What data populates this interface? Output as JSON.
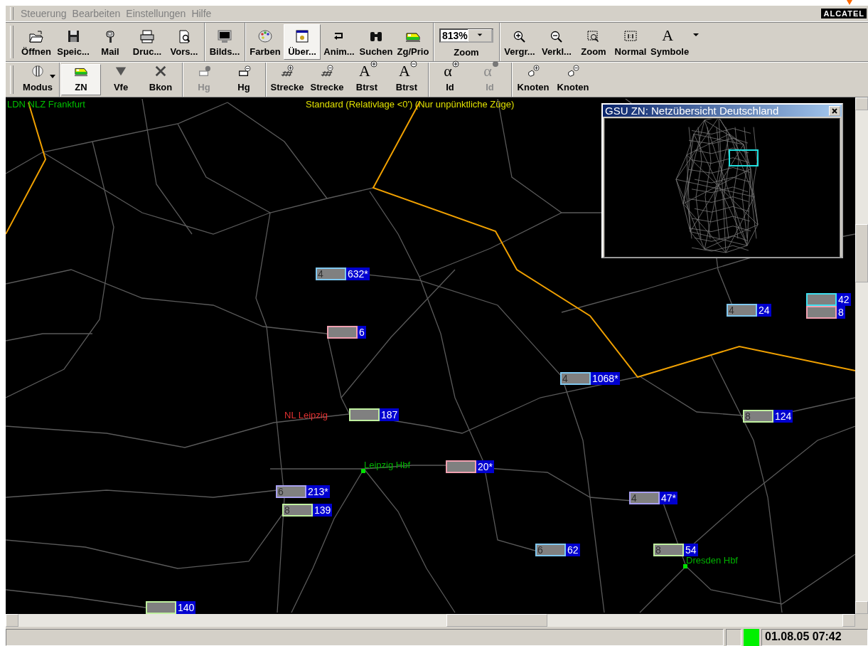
{
  "menu": [
    {
      "label": "Steuerung",
      "disabled": true
    },
    {
      "label": "Bearbeiten",
      "disabled": true
    },
    {
      "label": "Einstellungen",
      "disabled": true
    },
    {
      "label": "Hilfe",
      "disabled": true
    }
  ],
  "logo": "ALCATEL",
  "toolbars": [
    {
      "groups": [
        [
          {
            "kind": "button",
            "label": "Öffnen",
            "selected": false,
            "disabled": false
          },
          {
            "kind": "button",
            "label": "Speic...",
            "selected": false,
            "disabled": false
          },
          {
            "kind": "button",
            "label": "Mail",
            "selected": false,
            "disabled": false
          },
          {
            "kind": "button",
            "label": "Druc...",
            "selected": false,
            "disabled": false
          },
          {
            "kind": "button",
            "label": "Vors...",
            "selected": false,
            "disabled": false
          }
        ],
        [
          {
            "kind": "button",
            "label": "Bilds...",
            "selected": false,
            "disabled": false
          }
        ],
        [
          {
            "kind": "button",
            "label": "Farben",
            "selected": false,
            "disabled": false
          },
          {
            "kind": "button",
            "label": "Über...",
            "selected": true,
            "disabled": false
          },
          {
            "kind": "button",
            "label": "Anim...",
            "selected": false,
            "disabled": false
          },
          {
            "kind": "button",
            "label": "Suchen",
            "selected": false,
            "disabled": false
          },
          {
            "kind": "button",
            "label": "Zg/Prio",
            "selected": false,
            "disabled": false
          }
        ],
        [
          {
            "kind": "combo",
            "value": "813%",
            "label": "Zoom"
          }
        ],
        [
          {
            "kind": "button",
            "label": "Vergr...",
            "selected": false,
            "disabled": false
          },
          {
            "kind": "button",
            "label": "Verkl...",
            "selected": false,
            "disabled": false
          },
          {
            "kind": "button",
            "label": "Zoom",
            "selected": false,
            "disabled": false
          },
          {
            "kind": "button",
            "label": "Normal",
            "selected": false,
            "disabled": false
          },
          {
            "kind": "button",
            "glyph": "A",
            "label": "Symbole",
            "selected": false,
            "disabled": false
          },
          {
            "kind": "overflow"
          }
        ]
      ]
    },
    {
      "groups": [
        [
          {
            "kind": "menu-button",
            "label": "Modus",
            "selected": false,
            "disabled": false
          }
        ],
        [
          {
            "kind": "button",
            "label": "ZN",
            "selected": true,
            "disabled": false
          },
          {
            "kind": "button",
            "label": "Vfe",
            "selected": false,
            "disabled": false
          },
          {
            "kind": "button",
            "label": "Bkon",
            "selected": false,
            "disabled": false
          }
        ],
        [
          {
            "kind": "button",
            "label": "Hg",
            "selected": false,
            "disabled": true
          },
          {
            "kind": "button",
            "label": "Hg",
            "selected": false,
            "disabled": false
          }
        ],
        [
          {
            "kind": "button",
            "label": "Strecke",
            "selected": false,
            "disabled": false
          },
          {
            "kind": "button",
            "label": "Strecke",
            "selected": false,
            "disabled": false
          },
          {
            "kind": "button",
            "glyph": "A",
            "label": "Btrst",
            "selected": false,
            "disabled": false
          },
          {
            "kind": "button",
            "glyph": "A",
            "label": "Btrst",
            "selected": false,
            "disabled": false
          }
        ],
        [
          {
            "kind": "button",
            "glyph": "α",
            "label": "Id",
            "selected": false,
            "disabled": false
          },
          {
            "kind": "button",
            "glyph": "α",
            "label": "Id",
            "selected": false,
            "disabled": true
          }
        ],
        [
          {
            "kind": "button",
            "label": "Knoten",
            "selected": false,
            "disabled": false
          },
          {
            "kind": "button",
            "label": "Knoten",
            "selected": false,
            "disabled": false
          }
        ]
      ]
    }
  ],
  "map": {
    "labels": [
      {
        "kind": "region",
        "text": "LDN NLZ Frankfurt"
      },
      {
        "kind": "filter",
        "text": "Standard (Relativlage <0') (Nur unpünktliche Züge)"
      },
      {
        "kind": "district",
        "text": "NL Leipzig"
      },
      {
        "kind": "station",
        "text": "Leipzig Hbf"
      },
      {
        "kind": "station",
        "text": "Dresden Hbf"
      }
    ],
    "trains": [
      {
        "prefix": "4",
        "number": "632*",
        "color": "#80c8f0"
      },
      {
        "number": "6",
        "color": "#f0a0b0"
      },
      {
        "number": "187",
        "color": "#c0f0a0"
      },
      {
        "number": "20*",
        "color": "#f0a0b0"
      },
      {
        "prefix": "4",
        "number": "1068*",
        "color": "#80c8f0"
      },
      {
        "prefix": "4",
        "number": "24",
        "color": "#80c8f0"
      },
      {
        "number": "42",
        "color": "#40e0f0"
      },
      {
        "number": "8",
        "color": "#f0a0b0"
      },
      {
        "prefix": "8",
        "number": "124",
        "color": "#c0f0a0"
      },
      {
        "prefix": "6",
        "number": "213*",
        "color": "#a8a0f0"
      },
      {
        "prefix": "8",
        "number": "139",
        "color": "#c0f0a0"
      },
      {
        "prefix": "4",
        "number": "47*",
        "color": "#a8a0f0"
      },
      {
        "prefix": "6",
        "number": "62",
        "color": "#80c8f0"
      },
      {
        "prefix": "8",
        "number": "54",
        "color": "#c0f0a0"
      },
      {
        "number": "140",
        "color": "#c0f0a0"
      }
    ],
    "overview": {
      "title": "GSU ZN: Netzübersicht Deutschland"
    }
  },
  "status_bar": {
    "time": "01.08.05 07:42"
  }
}
